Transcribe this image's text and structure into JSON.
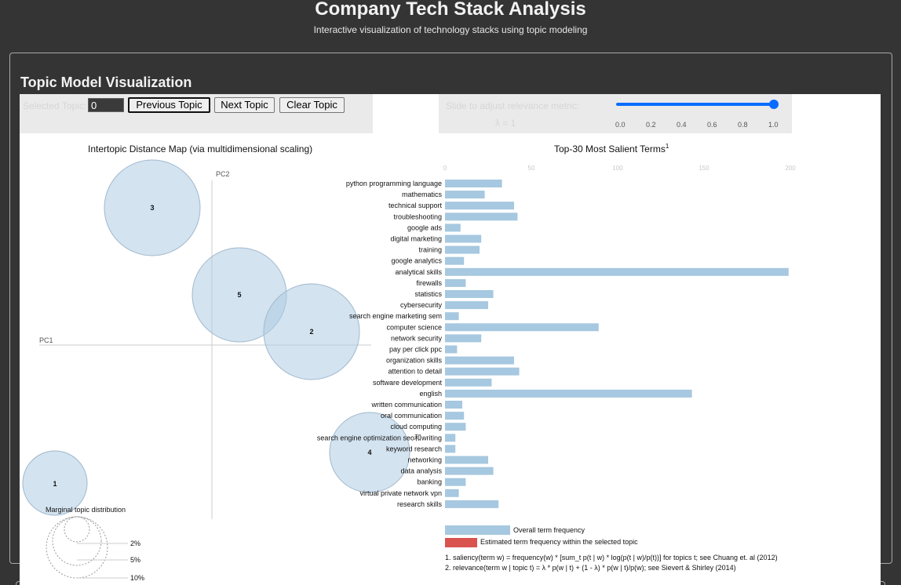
{
  "header": {
    "title": "Company Tech Stack Analysis",
    "subtitle": "Interactive visualization of technology stacks using topic modeling"
  },
  "card": {
    "title": "Topic Model Visualization"
  },
  "controls": {
    "selected_topic_label": "Selected Topic:",
    "topic_value": "0",
    "previous_label": "Previous Topic",
    "next_label": "Next Topic",
    "clear_label": "Clear Topic",
    "slider_label": "Slide to adjust relevance metric:",
    "lambda_label": "λ = 1",
    "lambda_value": 1.0,
    "slider_ticks": [
      "0.0",
      "0.2",
      "0.4",
      "0.6",
      "0.8",
      "1.0"
    ]
  },
  "intertopic": {
    "heading": "Intertopic Distance Map (via multidimensional scaling)",
    "pc1_label": "PC1",
    "pc2_label": "PC2",
    "topics": [
      "3",
      "5",
      "2",
      "4",
      "1"
    ],
    "marginal_label": "Marginal topic distribution",
    "marginal_levels": [
      "2%",
      "5%",
      "10%"
    ]
  },
  "terms": {
    "heading": "Top-30 Most Salient Terms",
    "heading_sup": "1",
    "legend_overall": "Overall term frequency",
    "legend_estimated": "Estimated term frequency within the selected topic",
    "footnote1": "1. saliency(term w) = frequency(w) * [sum_t p(t | w) * log(p(t | w)/p(t))] for topics t; see Chuang et. al (2012)",
    "footnote2": "2. relevance(term w | topic t) = λ * p(w | t) + (1 - λ) * p(w | t)/p(w); see Sievert & Shirley (2014)",
    "colors": {
      "overall": "#a6c8e0",
      "estimated": "#d9534f"
    }
  },
  "chart_data": {
    "type": "bar",
    "orientation": "horizontal",
    "title": "Top-30 Most Salient Terms",
    "xlim": [
      0,
      200
    ],
    "x_ticks": [
      "0",
      "50",
      "100",
      "150",
      "200"
    ],
    "categories": [
      "python programming language",
      "mathematics",
      "technical support",
      "troubleshooting",
      "google ads",
      "digital marketing",
      "training",
      "google analytics",
      "analytical skills",
      "firewalls",
      "statistics",
      "cybersecurity",
      "search engine marketing sem",
      "computer science",
      "network security",
      "pay per click ppc",
      "organization skills",
      "attention to detail",
      "software development",
      "english",
      "written communication",
      "oral communication",
      "cloud computing",
      "search engine optimization seo和writing",
      "keyword research",
      "networking",
      "data analysis",
      "banking",
      "virtual private network vpn",
      "research skills"
    ],
    "series": [
      {
        "name": "Overall term frequency",
        "values": [
          33,
          23,
          40,
          42,
          9,
          21,
          20,
          11,
          199,
          12,
          28,
          25,
          8,
          89,
          21,
          7,
          40,
          43,
          27,
          143,
          10,
          11,
          12,
          6,
          6,
          25,
          28,
          12,
          8,
          31
        ]
      }
    ]
  }
}
